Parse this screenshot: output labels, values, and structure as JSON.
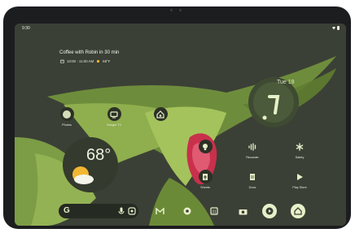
{
  "status_bar": {
    "time": "9:30"
  },
  "at_a_glance": {
    "title": "Coffee with Robin in 30 min",
    "time_range": "10:00 - 11:00 AM",
    "weather": "68°F"
  },
  "clock_widget": {
    "date": "Tue 19"
  },
  "weather_widget": {
    "temperature": "68°"
  },
  "apps": [
    {
      "label": "Photos",
      "icon": "pinwheel-icon"
    },
    {
      "label": "Google TV",
      "icon": "tv-icon"
    },
    {
      "label": "",
      "icon": "home-app-icon"
    },
    {
      "label": "Recorder",
      "icon": "waveform-icon"
    },
    {
      "label": "Safety",
      "icon": "asterisk-icon"
    },
    {
      "label": "Keep",
      "icon": "bulb-icon"
    },
    {
      "label": "Sheets",
      "icon": "sheets-icon"
    },
    {
      "label": "Docs",
      "icon": "docs-icon"
    },
    {
      "label": "Play Store",
      "icon": "play-icon"
    }
  ],
  "dock": {
    "apps": [
      "gmail-icon",
      "chrome-icon",
      "calendar-icon",
      "camera-icon",
      "youtube-icon",
      "home-icon"
    ]
  },
  "colors": {
    "widget": "#3e4a32",
    "accent": "#e7f0c8",
    "sun": "#f2b632"
  }
}
